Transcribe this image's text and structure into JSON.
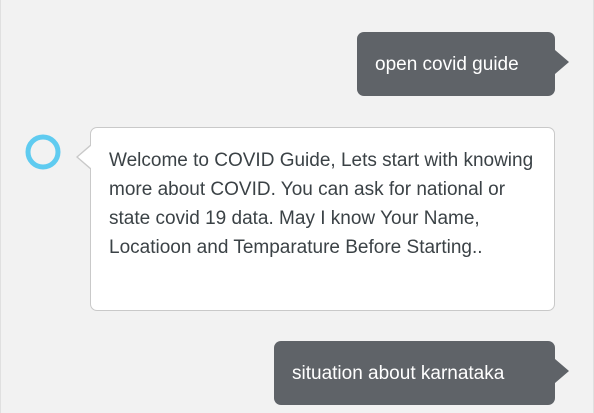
{
  "conversation": {
    "messages": [
      {
        "sender": "user",
        "text": "open covid guide"
      },
      {
        "sender": "assistant",
        "text": "Welcome to COVID Guide, Lets start with knowing more about COVID. You can ask for national or state covid 19 data. May I know Your Name, Locatioon and Temparature Before Starting.."
      },
      {
        "sender": "user",
        "text": "situation about karnataka"
      }
    ]
  },
  "assistant": {
    "icon": "alexa-ring-icon",
    "accent_color": "#5fcbf0"
  },
  "colors": {
    "background": "#f2f2f2",
    "user_bubble": "#5f6368",
    "assistant_bubble": "#ffffff",
    "assistant_border": "#c9c9c9"
  }
}
